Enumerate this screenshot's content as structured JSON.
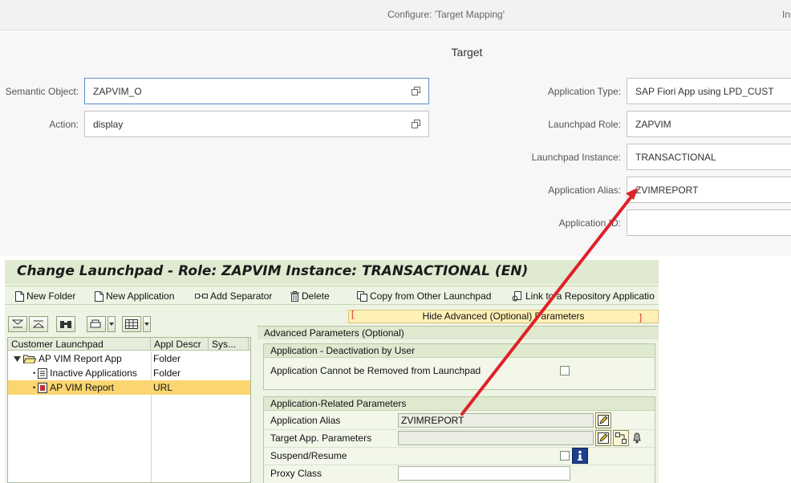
{
  "fiori": {
    "title": "Configure: 'Target Mapping'",
    "right_text": "Ins",
    "section_title": "Target",
    "left_fields": [
      {
        "label": "Semantic Object:",
        "value": "ZAPVIM_O"
      },
      {
        "label": "Action:",
        "value": "display"
      }
    ],
    "right_fields": [
      {
        "label": "Application Type:",
        "value": "SAP Fiori App using LPD_CUST"
      },
      {
        "label": "Launchpad Role:",
        "value": "ZAPVIM"
      },
      {
        "label": "Launchpad Instance:",
        "value": "TRANSACTIONAL"
      },
      {
        "label": "Application Alias:",
        "value": "ZVIMREPORT"
      },
      {
        "label": "Application ID:",
        "value": ""
      }
    ]
  },
  "sap": {
    "title": "Change Launchpad - Role: ZAPVIM Instance: TRANSACTIONAL (EN)",
    "toolbar": {
      "new_folder": "New Folder",
      "new_application": "New Application",
      "add_separator": "Add Separator",
      "delete": "Delete",
      "copy_from_other": "Copy from Other Launchpad",
      "link_to_repository": "Link to a Repository Applicatio"
    },
    "tree": {
      "columns": [
        "Customer Launchpad",
        "Appl Descr",
        "Sys..."
      ],
      "rows": [
        {
          "name": "AP VIM Report App",
          "type": "Folder"
        },
        {
          "name": "Inactive Applications",
          "type": "Folder"
        },
        {
          "name": "AP VIM Report",
          "type": "URL"
        }
      ]
    },
    "hide_advanced": "Hide Advanced (Optional) Parameters",
    "advanced_header": "Advanced Parameters (Optional)",
    "deactivation": {
      "title": "Application - Deactivation by User",
      "label": "Application Cannot be Removed from Launchpad"
    },
    "related": {
      "title": "Application-Related Parameters",
      "alias_label": "Application Alias",
      "alias_value": "ZVIMREPORT",
      "target_params_label": "Target App. Parameters",
      "target_params_value": "",
      "suspend_label": "Suspend/Resume",
      "proxy_label": "Proxy Class",
      "proxy_value": ""
    }
  },
  "colors": {
    "arrow": "#e0202a",
    "selected_row": "#fbd670",
    "sap_background": "#eef4e3"
  }
}
